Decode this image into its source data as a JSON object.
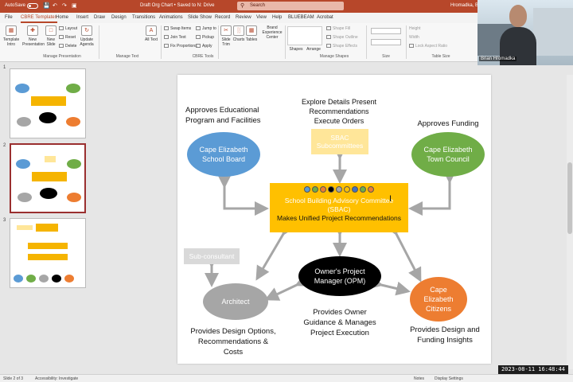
{
  "titlebar": {
    "autosave": "AutoSave",
    "doc_title": "Draft Org Chart • Saved to N: Drive",
    "search_placeholder": "Search",
    "user": "Hromadka, B"
  },
  "tabs": [
    "File",
    "CBRE Templates",
    "Home",
    "Insert",
    "Draw",
    "Design",
    "Transitions",
    "Animations",
    "Slide Show",
    "Record",
    "Review",
    "View",
    "Help",
    "BLUEBEAM",
    "Acrobat"
  ],
  "active_tab": "CBRE Templates",
  "ribbon": {
    "template_intro": "Template Intro",
    "new_presentation": "New Presentation",
    "new_slide": "New Slide",
    "layout": "Layout",
    "reset": "Reset",
    "delete": "Delete",
    "update_agenda": "Update Agenda",
    "group_manage_presentation": "Manage Presentation",
    "all_text": "All Text",
    "group_manage_text": "Manage Text",
    "swap_items": "Swap Items",
    "join_text": "Join Text",
    "fix_proportions": "Fix Proportions",
    "jump_to": "Jump to",
    "pickup": "Pickup",
    "apply": "Apply",
    "group_cbre_tools": "CBRE Tools",
    "slide_trim": "Slide Trim",
    "charts": "Charts",
    "tables": "Tables",
    "brand_center": "Brand Experience Center",
    "shapes": "Shapes",
    "arrange": "Arrange",
    "shape_fill": "Shape Fill",
    "shape_outline": "Shape Outline",
    "shape_effects": "Shape Effects",
    "group_manage_shapes": "Manage Shapes",
    "group_size": "Size",
    "height": "Height",
    "width": "Width",
    "lock_aspect": "Lock Aspect Ratio",
    "group_table_size": "Table Size"
  },
  "video": {
    "name": "Brian Hromadka"
  },
  "thumbnails": [
    {
      "num": "1",
      "selected": false
    },
    {
      "num": "2",
      "selected": true
    },
    {
      "num": "3",
      "selected": false
    }
  ],
  "slide": {
    "approves_educational": "Approves Educational Program and Facilities",
    "explore_details": "Explore Details Present Recommendations Execute Orders",
    "approves_funding": "Approves Funding",
    "school_board": "Cape Elizabeth School Board",
    "sbac_subcommittees": "SBAC Subcommittees",
    "town_council": "Cape Elizabeth Town Council",
    "sbac_name": "School Building Advisory Committee (SBAC)",
    "sbac_role": "Makes Unified Project Recommendations",
    "sub_consultant": "Sub-consultant",
    "opm": "Owner's Project Manager (OPM)",
    "architect": "Architect",
    "citizens": "Cape Elizabeth Citizens",
    "architect_desc": "Provides Design Options, Recommendations & Costs",
    "opm_desc": "Provides Owner Guidance & Manages Project Execution",
    "citizens_desc": "Provides Design and Funding Insights",
    "colors": {
      "blue": "#5b9bd5",
      "green": "#70ad47",
      "orange": "#ed7d31",
      "gold": "#ffc000",
      "gray": "#a6a6a6",
      "black": "#000000",
      "pale_gold": "#ffe699",
      "light_gray": "#d9d9d9"
    },
    "dot_colors": [
      "#5b9bd5",
      "#70ad47",
      "#ed7d31",
      "#000000",
      "#a6a6a6",
      "#ffc000",
      "#4472c4",
      "#70ad47",
      "#ed7d31"
    ]
  },
  "status": {
    "slide_of": "Slide 2 of 3",
    "accessibility": "Accessibility: Investigate",
    "notes": "Notes",
    "display_settings": "Display Settings"
  },
  "clock": "2023-08-11  16:48:44"
}
